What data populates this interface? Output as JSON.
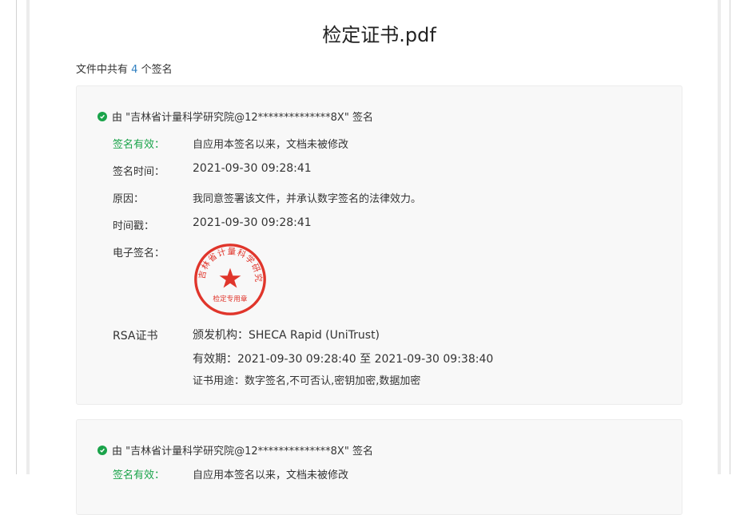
{
  "page_title": "检定证书.pdf",
  "summary": {
    "prefix": "文件中共有",
    "count": "4",
    "suffix": "个签名"
  },
  "signatures": [
    {
      "signer_text": "由 \"吉林省计量科学研究院@12**************8X\" 签名",
      "status_label": "签名有效：",
      "status_value": "自应用本签名以来，文档未被修改",
      "time_label": "签名时间：",
      "time_value": "2021-09-30 09:28:41",
      "reason_label": "原因：",
      "reason_value": "我同意签署该文件，并承认数字签名的法律效力。",
      "timestamp_label": "时间戳：",
      "timestamp_value": "2021-09-30 09:28:41",
      "esign_label": "电子签名：",
      "seal": {
        "ring_text": "吉林省计量科学研究院",
        "bottom_text": "检定专用章",
        "color": "#e0352b"
      },
      "cert_label": "RSA证书",
      "issuer": "颁发机构：SHECA Rapid (UniTrust)",
      "validity": "有效期：2021-09-30 09:28:40 至 2021-09-30 09:38:40",
      "usage": "证书用途：数字签名,不可否认,密钥加密,数据加密"
    },
    {
      "signer_text": "由 \"吉林省计量科学研究院@12**************8X\" 签名",
      "status_label": "签名有效：",
      "status_value": "自应用本签名以来，文档未被修改"
    }
  ],
  "colors": {
    "valid": "#1aa34a",
    "count": "#2f7fc1",
    "seal": "#e0352b"
  }
}
